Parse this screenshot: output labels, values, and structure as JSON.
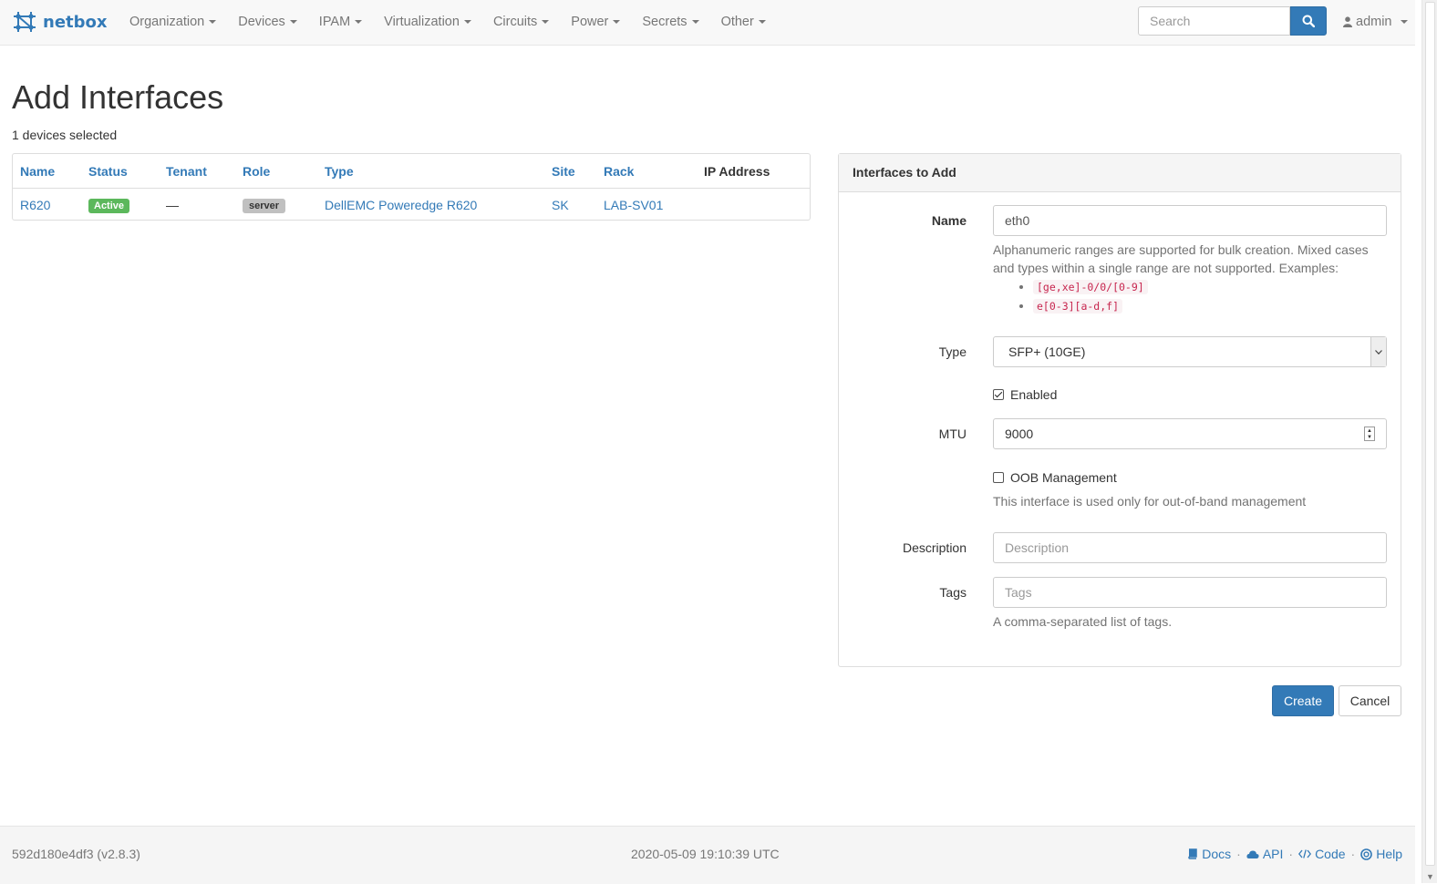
{
  "brand": {
    "name": "netbox"
  },
  "nav": {
    "items": [
      {
        "label": "Organization"
      },
      {
        "label": "Devices"
      },
      {
        "label": "IPAM"
      },
      {
        "label": "Virtualization"
      },
      {
        "label": "Circuits"
      },
      {
        "label": "Power"
      },
      {
        "label": "Secrets"
      },
      {
        "label": "Other"
      }
    ],
    "search_placeholder": "Search",
    "user": "admin"
  },
  "page": {
    "title": "Add Interfaces",
    "selected_count": "1 devices selected"
  },
  "devices_table": {
    "headers": [
      "Name",
      "Status",
      "Tenant",
      "Role",
      "Type",
      "Site",
      "Rack",
      "IP Address"
    ],
    "rows": [
      {
        "name": "R620",
        "status": "Active",
        "tenant": "—",
        "role": "server",
        "type": "DellEMC Poweredge R620",
        "site": "SK",
        "rack": "LAB-SV01",
        "ip": ""
      }
    ]
  },
  "form": {
    "panel_title": "Interfaces to Add",
    "name_label": "Name",
    "name_value": "eth0",
    "name_help": "Alphanumeric ranges are supported for bulk creation. Mixed cases and types within a single range are not supported. Examples:",
    "name_examples": [
      "[ge,xe]-0/0/[0-9]",
      "e[0-3][a-d,f]"
    ],
    "type_label": "Type",
    "type_value": "SFP+ (10GE)",
    "enabled_label": "Enabled",
    "enabled_checked": true,
    "mtu_label": "MTU",
    "mtu_value": "9000",
    "oob_label": "OOB Management",
    "oob_checked": false,
    "oob_help": "This interface is used only for out-of-band management",
    "description_label": "Description",
    "description_placeholder": "Description",
    "tags_label": "Tags",
    "tags_placeholder": "Tags",
    "tags_help": "A comma-separated list of tags.",
    "create_label": "Create",
    "cancel_label": "Cancel"
  },
  "footer": {
    "version": "592d180e4df3 (v2.8.3)",
    "timestamp": "2020-05-09 19:10:39 UTC",
    "links": [
      {
        "label": "Docs",
        "icon": "book-icon"
      },
      {
        "label": "API",
        "icon": "cloud-icon"
      },
      {
        "label": "Code",
        "icon": "code-icon"
      },
      {
        "label": "Help",
        "icon": "lifebuoy-icon"
      }
    ]
  },
  "colors": {
    "primary": "#337ab7",
    "success": "#5cb85c",
    "navbar_bg": "#f8f8f8"
  }
}
